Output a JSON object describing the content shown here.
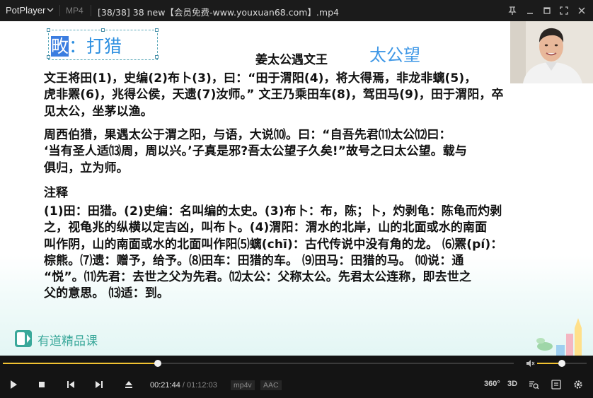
{
  "app": {
    "name": "PotPlayer",
    "format": "MP4",
    "window_title": "[38/38] 38 new【会员免费-www.youxuan68.com】.mp4"
  },
  "video": {
    "selection_text_highlight": "畋",
    "selection_text_rest": "：打猎",
    "doc_title": "姜太公遇文王",
    "side_note": "太公望",
    "para1": [
      "    文王将田(1)，史编(2)布卜(3)，曰：“田于渭阳(4)，将大得焉，非龙非螭(5)，",
      "虎非罴(6)，兆得公侯，天遗(7)汝师。” 文王乃乘田车(8)，驾田马(9)，田于渭阳，卒",
      "见太公，坐茅以渔。"
    ],
    "para2": [
      "    周西伯猎，果遇太公于渭之阳，与语，大说⑽。曰：“自吾先君⑾太公⑿曰：",
      "‘当有圣人适⒀周，周以兴。’子真是邪?吾太公望子久矣!”故号之曰太公望。载与",
      "俱归，立为师。"
    ],
    "notes_heading": "注释",
    "notes": [
      "(1)田：田猎。(2)史编：名叫编的太史。(3)布卜：布，陈；卜，灼剥龟：陈龟而灼剥",
      "之，视龟兆的纵横以定吉凶，叫布卜。(4)渭阳：渭水的北岸，山的北面或水的南面",
      "叫作阴，山的南面或水的北面叫作阳⑸螭(chī)：古代传说中没有角的龙。  ⑹罴(pí)：",
      "棕熊。⑺遗：赠予，给予。⑻田车：田猎的车。  ⑼田马：田猎的马。  ⑽说：通",
      "“悦”。⑾先君：去世之父为先君。⑿太公：父称太公。先君太公连称，即去世之",
      "父的意思。 ⒀适：到。"
    ],
    "brand": "有道精品课"
  },
  "playback": {
    "current_time": "00:21:44",
    "separator": " / ",
    "total_time": "01:12:03",
    "progress": 0.303,
    "volume": 0.5,
    "codec_video": "mp4v",
    "codec_audio": "AAC",
    "label_360": "360°",
    "label_3d": "3D"
  },
  "colors": {
    "accent": "#f1c232",
    "bg": "#141414",
    "brand_green": "#3aa89a",
    "note_blue": "#3e97e6"
  }
}
